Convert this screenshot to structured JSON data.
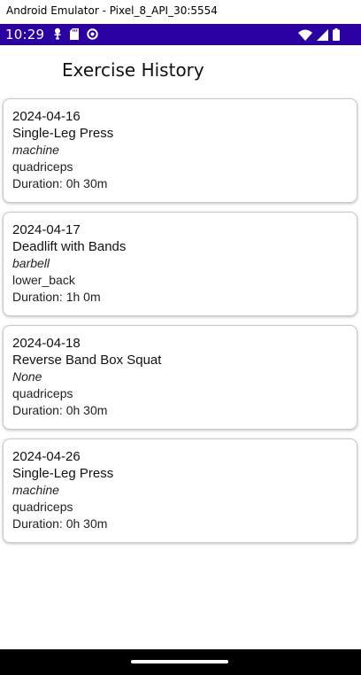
{
  "window": {
    "title": "Android Emulator - Pixel_8_API_30:5554"
  },
  "status_bar": {
    "time": "10:29",
    "left_icons": [
      "usb-debug-icon",
      "sd-card-icon",
      "sync-icon"
    ],
    "right_icons": [
      "wifi-icon",
      "signal-icon",
      "battery-icon"
    ],
    "color": "#2a00a3"
  },
  "header": {
    "title": "Exercise History"
  },
  "entries": [
    {
      "date": "2024-04-16",
      "name": "Single-Leg Press",
      "equipment": "machine",
      "muscle": "quadriceps",
      "duration": "Duration: 0h 30m"
    },
    {
      "date": "2024-04-17",
      "name": "Deadlift with Bands",
      "equipment": "barbell",
      "muscle": "lower_back",
      "duration": "Duration: 1h 0m"
    },
    {
      "date": "2024-04-18",
      "name": "Reverse Band Box Squat",
      "equipment": "None",
      "muscle": "quadriceps",
      "duration": "Duration: 0h 30m"
    },
    {
      "date": "2024-04-26",
      "name": "Single-Leg Press",
      "equipment": "machine",
      "muscle": "quadriceps",
      "duration": "Duration: 0h 30m"
    }
  ]
}
